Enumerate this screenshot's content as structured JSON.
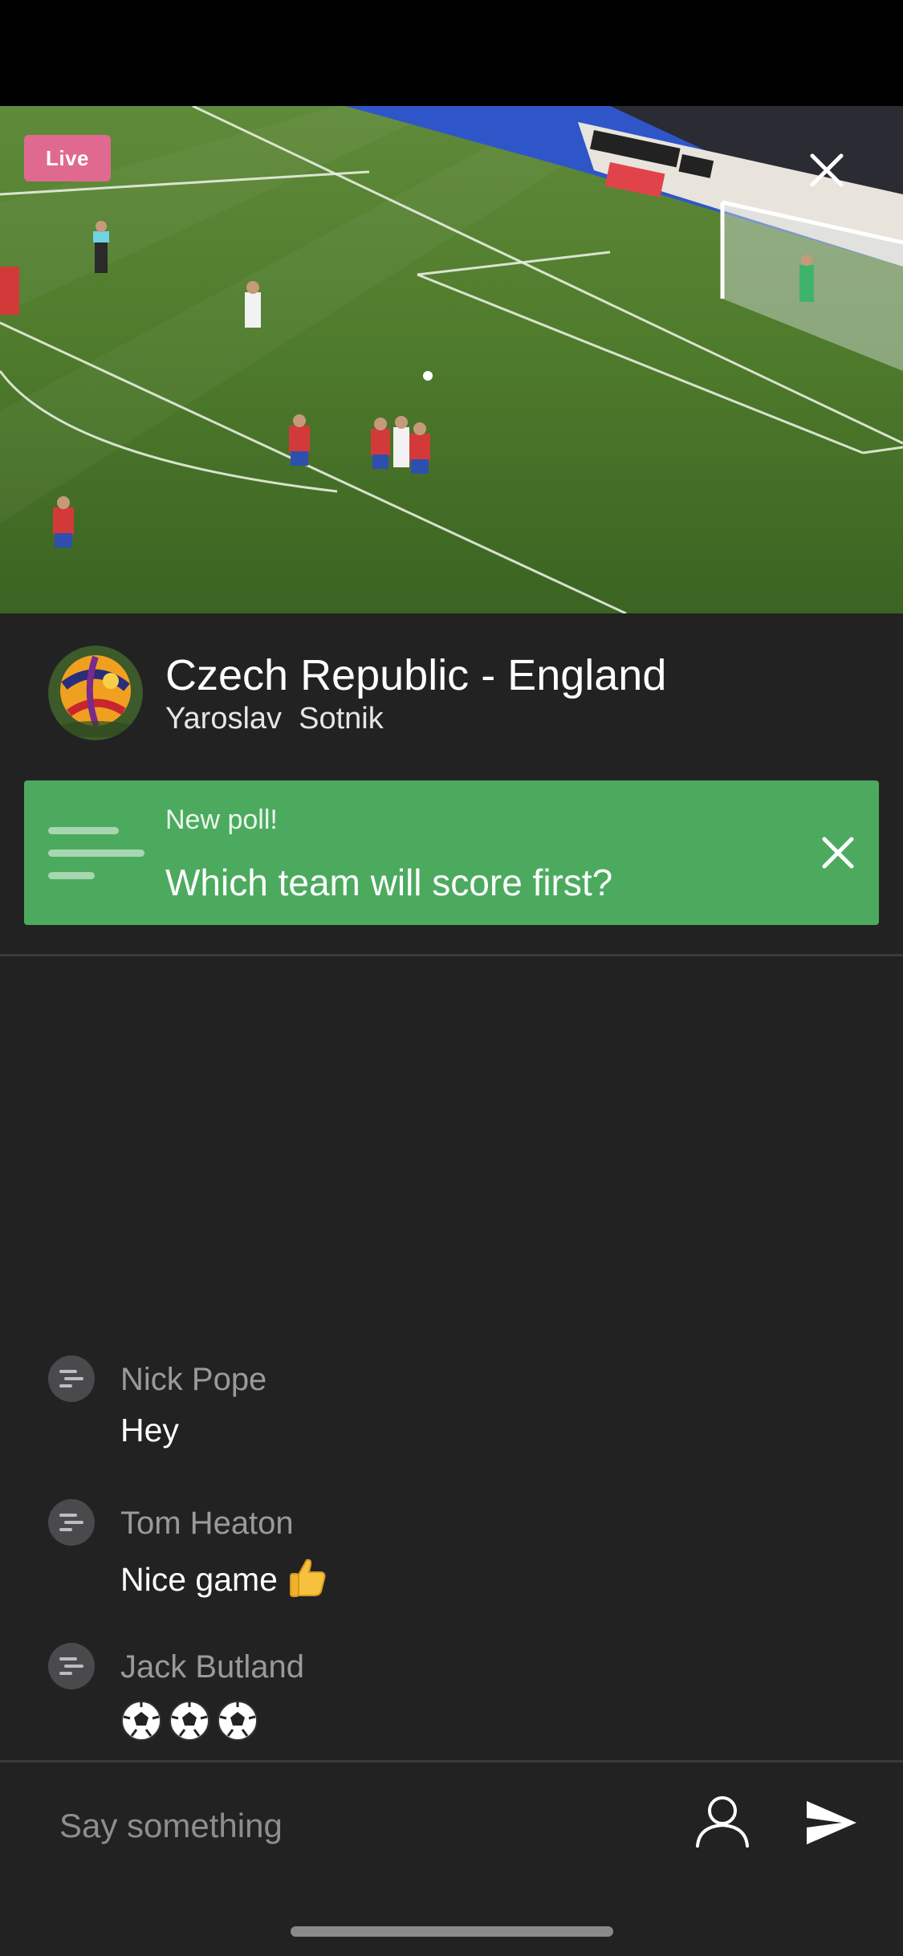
{
  "stream": {
    "live_badge": "Live",
    "title": "Czech Republic - England",
    "author": "Yaroslav  Sotnik"
  },
  "poll": {
    "kicker": "New poll!",
    "question": "Which team will score first?"
  },
  "chat": [
    {
      "name": "Nick Pope",
      "text": "Hey"
    },
    {
      "name": "Tom Heaton",
      "text": "Nice game"
    },
    {
      "name": "Jack Butland",
      "text": ""
    }
  ],
  "composer": {
    "placeholder": "Say something"
  },
  "icons": {
    "close": "close-icon",
    "poll": "poll-icon",
    "profile": "person-icon",
    "send": "send-icon",
    "thumb": "thumbs-up-emoji",
    "ball": "soccer-ball-emoji"
  },
  "colors": {
    "live": "#e06a8f",
    "poll_bg": "#4caa5f",
    "background": "#222223"
  }
}
